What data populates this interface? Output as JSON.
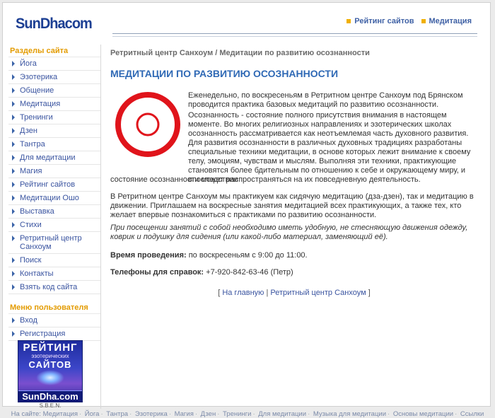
{
  "header": {
    "logo": "SunDhacom",
    "toplinks": [
      "Рейтинг сайтов",
      "Медитация"
    ]
  },
  "sidebar": {
    "sections_title": "Разделы сайта",
    "items": [
      "Йога",
      "Эзотерика",
      "Общение",
      "Медитация",
      "Тренинги",
      "Дзен",
      "Тантра",
      "Для медитации",
      "Магия",
      "Рейтинг сайтов",
      "Медитации Ошо",
      "Выставка",
      "Стихи",
      "Ретритный центр Санхоум",
      "Поиск",
      "Контакты",
      "Взять код сайта"
    ],
    "user_title": "Меню пользователя",
    "user_items": [
      "Вход",
      "Регистрация"
    ],
    "banner": {
      "line1": "РЕЙТИНГ",
      "line2": "эзотерических",
      "line3": "САЙТОВ",
      "line4": "SunDha.com",
      "caption": "S.B.E.N."
    }
  },
  "main": {
    "breadcrumb": "Ретритный центр Санхоум / Медитации по развитию осознанности",
    "title": "МЕДИТАЦИИ ПО РАЗВИТИЮ ОСОЗНАННОСТИ",
    "paragraph1": "Еженедельно, по воскресеньям в Ретритном центре Санхоум под Брянском проводится практика базовых медитаций по развитию осознанности.",
    "paragraph2a": "Осознанность - состояние полного присутствия внимания в настоящем моменте. Во многих религиозных направлениях и эзотерических школах осознанность рассматривается как неотъемлемая часть духовного развития. Для развития осознанности в различных духовных традициях разработаны специальные техники медитации, в основе которых лежит внимание к своему телу, эмоциям, чувствам и мыслям. Выполняя эти техники, практикующие становятся более бдительным по отношению к себе и окружающему миру, и впоследствии",
    "paragraph2b": "состояние осознанности может распространяться на их повседневную деятельность.",
    "paragraph3": "В Ретритном центре Санхоум мы практикуем как сидячую медитацию (дза-дзен), так и медитацию в движении. Приглашаем на воскресные занятия медитацией всех практикующих, а также тех, кто желает впервые познакомиться с практиками по развитию осознанности.",
    "paragraph4": "При посещении занятий с собой необходимо иметь удобную, не стесняющую движения одежду, коврик и подушку для сидения (или какой-либо материал, заменяющий её).",
    "time_label": "Время проведения:",
    "time_value": " по воскресеньям с 9:00 до 11:00.",
    "phone_label": "Телефоны для справок:",
    "phone_value": " +7-920-842-63-46 (Петр)",
    "link_home": "На главную",
    "link_center": "Ретритный центр Санхоум"
  },
  "footer": {
    "prefix": "На сайте:",
    "links": [
      "Медитация",
      "Йога",
      "Тантра",
      "Эзотерика",
      "Магия",
      "Дзен",
      "Тренинги",
      "Для медитации",
      "Музыка для медитации",
      "Основы медитации",
      "Ссылки"
    ]
  }
}
